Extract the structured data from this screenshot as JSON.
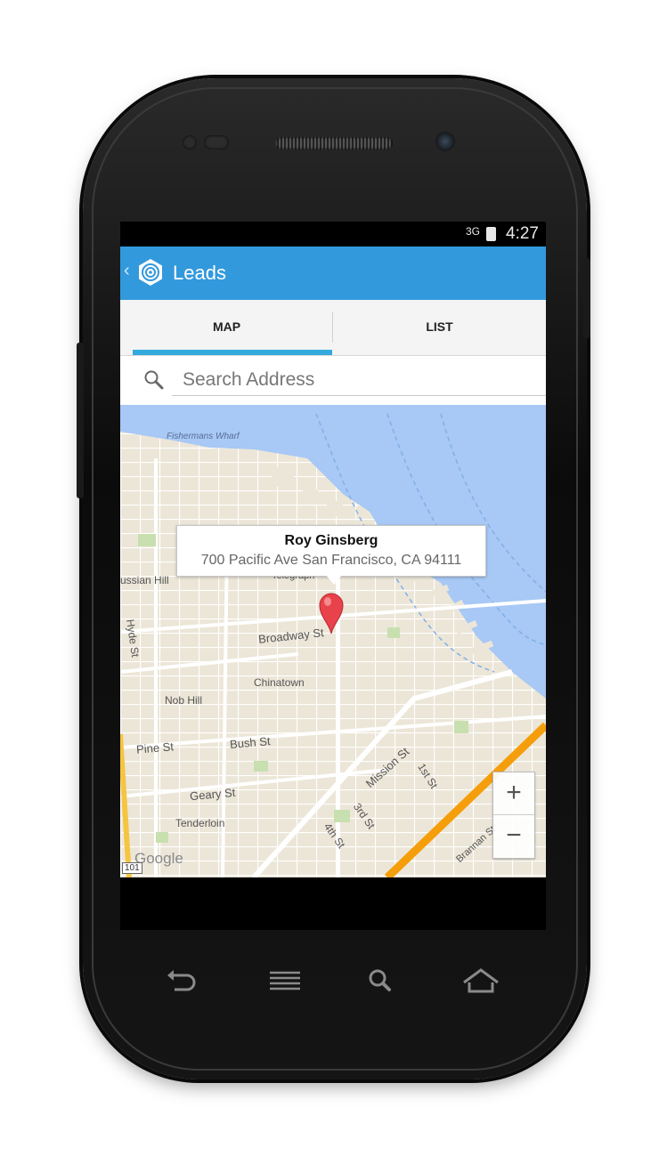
{
  "status_bar": {
    "network": "3G",
    "time": "4:27"
  },
  "action_bar": {
    "title": "Leads",
    "color": "#3399dd"
  },
  "tabs": [
    {
      "label": "MAP",
      "selected": true
    },
    {
      "label": "LIST",
      "selected": false
    }
  ],
  "search": {
    "placeholder": "Search Address",
    "value": ""
  },
  "map": {
    "labels": {
      "fishermans_wharf": "Fishermans Wharf",
      "russian_hill": "ussian Hill",
      "hyde_st": "Hyde St",
      "broadway_st": "Broadway St",
      "telegraph": "Telegraph",
      "chinatown": "Chinatown",
      "nob_hill": "Nob Hill",
      "pine_st": "Pine St",
      "bush_st": "Bush St",
      "mission_st": "Mission St",
      "first_st": "1st St",
      "geary_st": "Geary St",
      "tenderloin": "Tenderloin",
      "third_st": "3rd St",
      "fourth_st": "4th St",
      "brannan_st": "Brannan St",
      "google": "Google",
      "route_101": "101"
    },
    "marker": {
      "name": "Roy Ginsberg",
      "address": "700 Pacific Ave San Francisco, CA 94111"
    },
    "zoom_in_label": "+",
    "zoom_out_label": "−"
  },
  "nav_bar": {
    "icons": [
      "back-icon",
      "menu-icon",
      "search-icon",
      "home-icon"
    ]
  }
}
